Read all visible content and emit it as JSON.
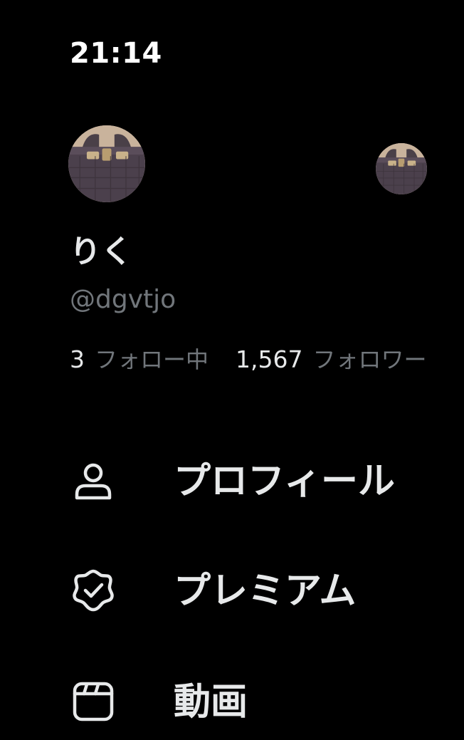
{
  "status_bar": {
    "time": "21:14"
  },
  "profile": {
    "display_name": "りく",
    "handle": "@dgvtjo",
    "following_count": "3",
    "following_label": "フォロー中",
    "followers_count": "1,567",
    "followers_label": "フォロワー"
  },
  "menu": {
    "items": [
      {
        "label": "プロフィール",
        "icon": "person-icon"
      },
      {
        "label": "プレミアム",
        "icon": "verified-badge-icon"
      },
      {
        "label": "動画",
        "icon": "video-clapper-icon"
      }
    ]
  },
  "colors": {
    "background": "#000000",
    "primary_text": "#e7e9ea",
    "secondary_text": "#71767b"
  }
}
